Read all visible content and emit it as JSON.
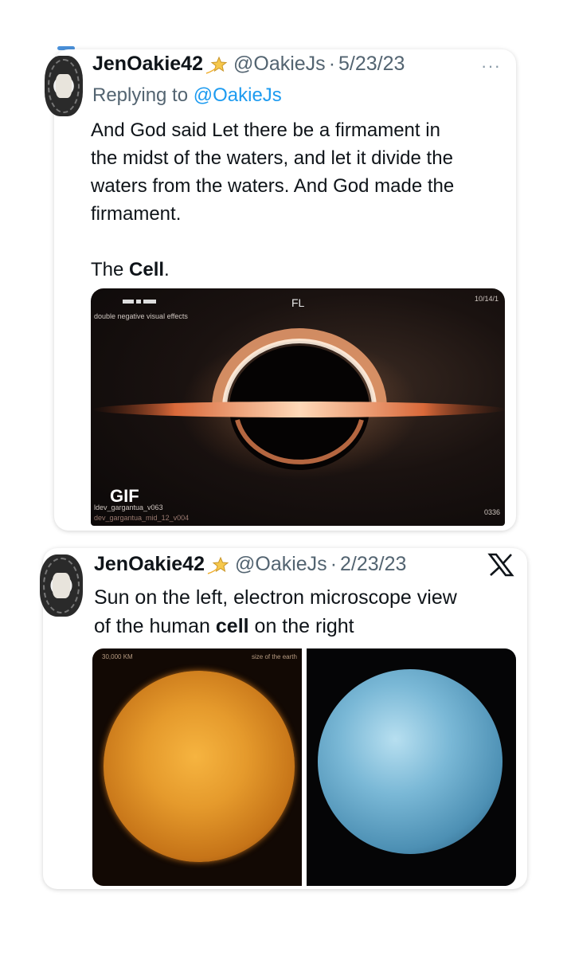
{
  "tweet1": {
    "name": "JenOakie42",
    "handle": "@OakieJs",
    "separator": "·",
    "date": "5/23/23",
    "more_label": "···",
    "replying_prefix": "Replying to ",
    "replying_mention": "@OakieJs",
    "lines": [
      "And God said Let there be a firmament in",
      "the midst of the waters, and let it divide the",
      "waters from the waters. And God made the",
      "firmament."
    ],
    "last_prefix": "The ",
    "last_bold": "Cell",
    "last_suffix": ".",
    "media": {
      "gif_label": "GIF",
      "overlay_fl": "FL",
      "overlay_date": "10/14/1",
      "overlay_code": "0336",
      "overlay_file": "ldev_gargantua_v063",
      "overlay_file2": "dev_gargantua_mid_12_v004",
      "overlay_corner": "double negative visual effects"
    }
  },
  "tweet2": {
    "name": "JenOakie42",
    "handle": "@OakieJs",
    "separator": "·",
    "date": "2/23/23",
    "text_line1": "Sun on the left, electron microscope view",
    "text_prefix": "of the human ",
    "text_bold": "cell",
    "text_suffix": " on the right",
    "sun_caption_left": "30,000 KM",
    "sun_caption_right": "size of the earth"
  },
  "colors": {
    "accent": "#1d9bf0",
    "secondary_text": "#536471"
  }
}
